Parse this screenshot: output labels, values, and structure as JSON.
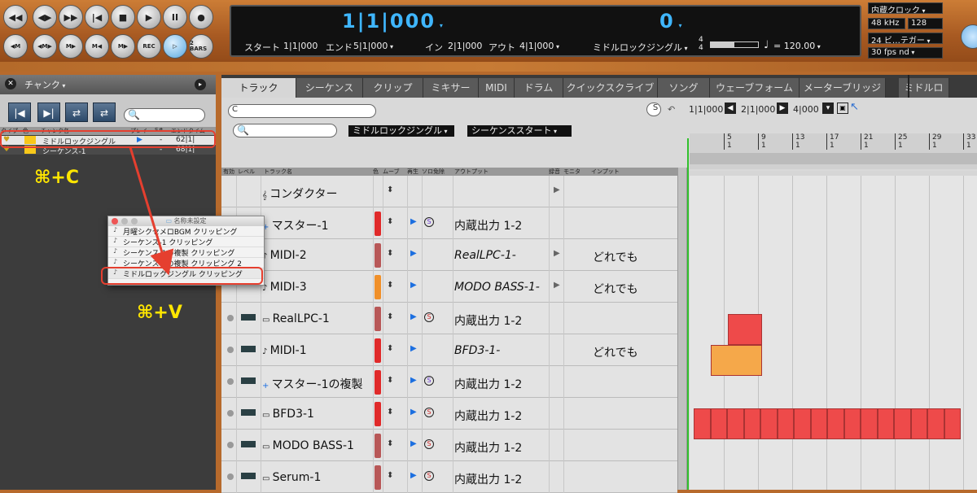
{
  "transport": {
    "row1": [
      "◀◀",
      "◀▶",
      "▶▶",
      "|◀",
      "■",
      "▶",
      "II",
      "●"
    ],
    "row2": [
      "◀M",
      "◀M▶",
      "M▶",
      "M◀",
      "M▶",
      "REC",
      "▷",
      "2 BARS"
    ]
  },
  "counter": {
    "position": "1|1|000",
    "secondary": "0",
    "start_label": "スタート",
    "start_value": "1|1|000",
    "end_label": "エンド",
    "end_value": "5|1|000",
    "in_label": "イン",
    "in_value": "2|1|000",
    "out_label": "アウト",
    "out_value": "4|1|000",
    "sequence": "ミドルロックジングル",
    "meter_top": "4",
    "meter_bottom": "4",
    "progress_fraction": 0.5,
    "tempo_note": "♩",
    "tempo": "= 120.00"
  },
  "right_panel": {
    "clock": "内蔵クロック",
    "rate": "48 kHz",
    "buffer": "128",
    "bits": "24 ビ…テガー",
    "fps": "30 fps nd"
  },
  "chunk_panel": {
    "title": "チャンク",
    "close": "✕",
    "headers": [
      "タイプ",
      "色",
      "チャンク名",
      "プレイ",
      "S#",
      "エンドタイム"
    ],
    "rows": [
      {
        "name": "ミドルロックジングル",
        "play": "▶",
        "snum": "-",
        "end": "62|1|"
      },
      {
        "name": "シーケンス-1",
        "play": "",
        "snum": "-",
        "end": "68|1|"
      }
    ],
    "search_icon": "🔍"
  },
  "annotations": {
    "copy": "⌘+C",
    "paste": "⌘+V"
  },
  "popup": {
    "title": "名称未設定",
    "items": [
      "月曜シクセメロBGM クリッピング",
      "シーケンス-1 クリッピング",
      "シーケンス-1の複製 クリッピング",
      "シーケンス-1の複製 クリッピング 2",
      "ミドルロックジングル クリッピング"
    ]
  },
  "tabs": [
    "トラック",
    "シーケンス",
    "クリップ",
    "ミキサー",
    "MIDI",
    "ドラム",
    "クイックスクライブ",
    "ソング",
    "ウェーブフォーム",
    "メーターブリッジ",
    "ミドルロ"
  ],
  "toolbar": {
    "c_label": "C",
    "s_label": "S",
    "seq_dropdown": "ミドルロックジングル",
    "start_dropdown": "シーケンススタート",
    "loc1": "1|1|000",
    "loc2": "2|1|000",
    "loc3": "4|000"
  },
  "track_headers": [
    "有効",
    "レベル",
    "トラック名",
    "色",
    "ムーブ",
    "再生",
    "ソロ免除",
    "アウトプット",
    "録音",
    "モニタ",
    "インプット"
  ],
  "tracks": [
    {
      "name": "コンダクター",
      "icon": "𝄞",
      "color": "",
      "output": "",
      "input": "",
      "solo": "",
      "play": "",
      "italic": false,
      "rec": "▶"
    },
    {
      "name": "マスター-1",
      "icon": "+",
      "color": "#e02a2a",
      "output": "内蔵出力 1-2",
      "input": "",
      "solo": "S",
      "play": "▶",
      "italic": false,
      "rec": ""
    },
    {
      "name": "MIDI-2",
      "icon": "♪",
      "color": "#b85858",
      "output": "RealLPC-1-",
      "input": "どれでも",
      "solo": "",
      "play": "▶",
      "italic": true,
      "rec": "▶"
    },
    {
      "name": "MIDI-3",
      "icon": "♪",
      "color": "#f0902a",
      "output": "MODO BASS-1-",
      "input": "どれでも",
      "solo": "",
      "play": "▶",
      "italic": true,
      "rec": "▶"
    },
    {
      "name": "RealLPC-1",
      "icon": "▭",
      "color": "#b85858",
      "output": "内蔵出力 1-2",
      "input": "",
      "solo": "S",
      "play": "▶",
      "italic": false,
      "rec": ""
    },
    {
      "name": "MIDI-1",
      "icon": "♪",
      "color": "#e02a2a",
      "output": "BFD3-1-",
      "input": "どれでも",
      "solo": "",
      "play": "▶",
      "italic": true,
      "rec": ""
    },
    {
      "name": "マスター-1の複製",
      "icon": "+",
      "color": "#e02a2a",
      "output": "内蔵出力 1-2",
      "input": "",
      "solo": "S",
      "play": "▶",
      "italic": false,
      "rec": ""
    },
    {
      "name": "BFD3-1",
      "icon": "▭",
      "color": "#e02a2a",
      "output": "内蔵出力 1-2",
      "input": "",
      "solo": "S",
      "play": "▶",
      "italic": false,
      "rec": ""
    },
    {
      "name": "MODO BASS-1",
      "icon": "▭",
      "color": "#b85858",
      "output": "内蔵出力 1-2",
      "input": "",
      "solo": "S",
      "play": "▶",
      "italic": false,
      "rec": ""
    },
    {
      "name": "Serum-1",
      "icon": "▭",
      "color": "#b85858",
      "output": "内蔵出力 1-2",
      "input": "",
      "solo": "S",
      "play": "▶",
      "italic": false,
      "rec": ""
    }
  ],
  "ruler": {
    "marks": [
      "5",
      "9",
      "13",
      "17",
      "21",
      "25",
      "29",
      "33"
    ],
    "beat": "1"
  },
  "colors": {
    "clip_red": "#ee4a4a",
    "clip_orange": "#f5a84a",
    "cursor": "#31c02c",
    "highlight": "#e53f2f"
  }
}
